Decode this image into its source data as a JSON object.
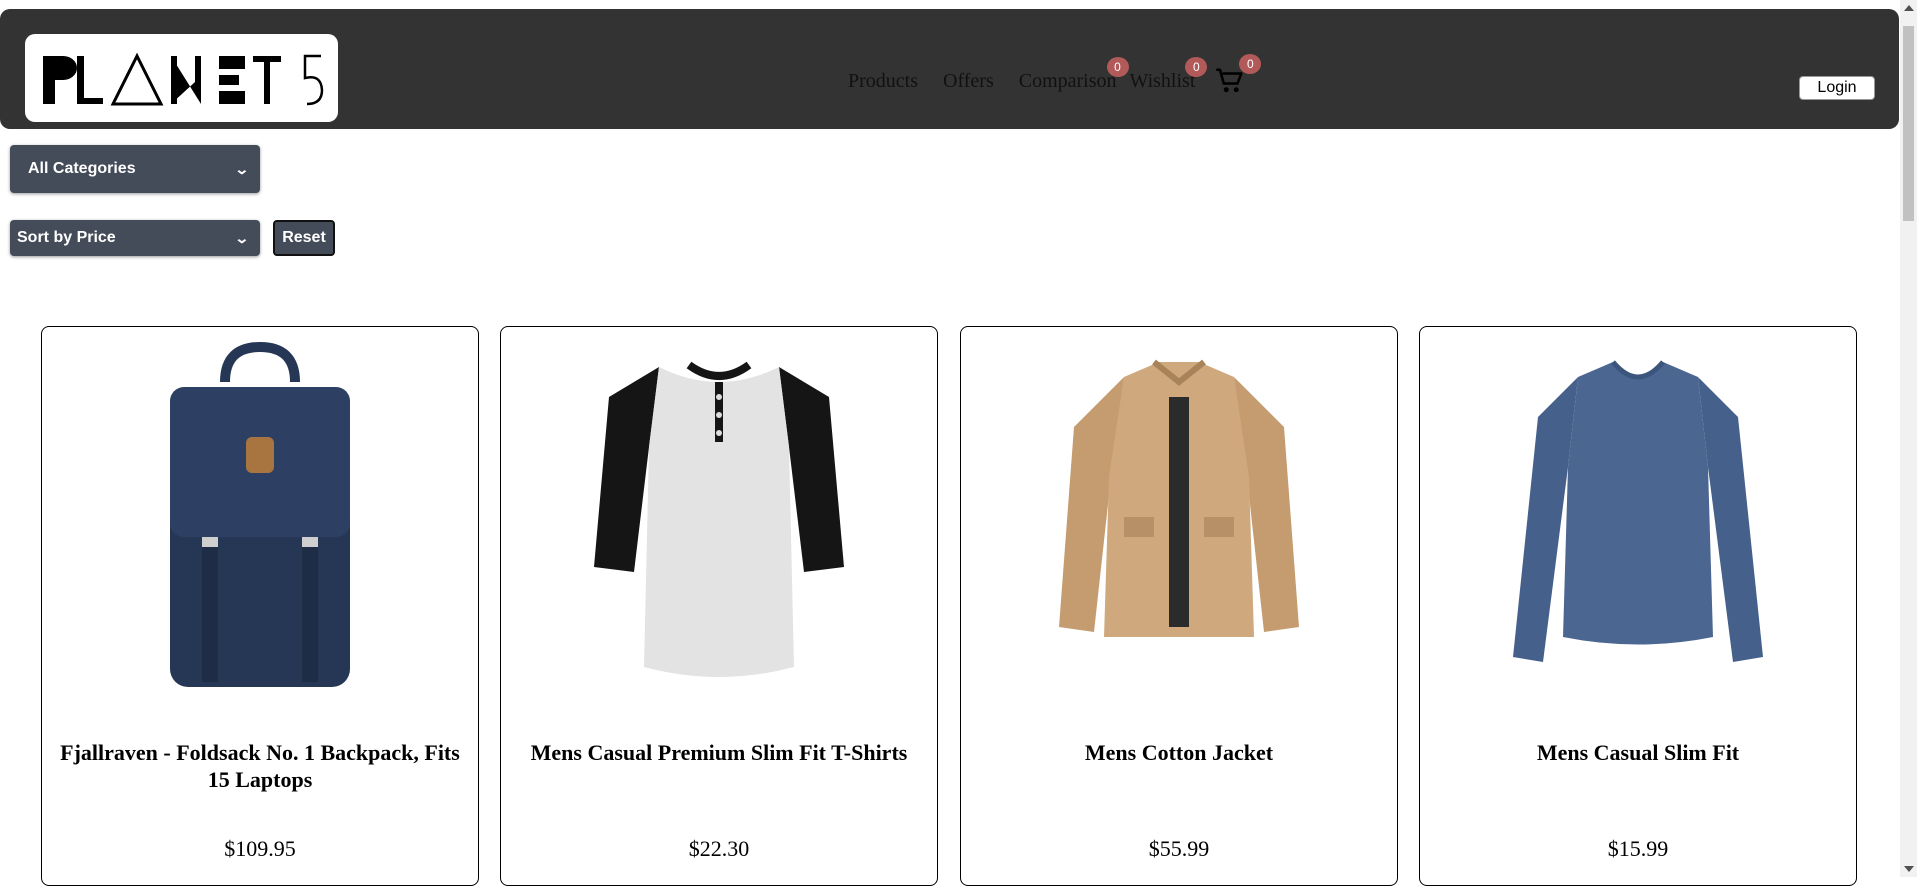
{
  "header": {
    "logo_text": "PLANET 5",
    "nav": [
      {
        "label": "Products"
      },
      {
        "label": "Offers"
      },
      {
        "label": "Comparison",
        "badge": "0"
      },
      {
        "label": "Wishlist",
        "badge": "0"
      }
    ],
    "cart": {
      "icon": "cart-icon",
      "badge": "0"
    },
    "login_label": "Login"
  },
  "filters": {
    "category_selected": "All Categories",
    "sort_selected": "Sort by Price",
    "reset_label": "Reset"
  },
  "products": [
    {
      "title": "Fjallraven - Foldsack No. 1 Backpack, Fits 15 Laptops",
      "price": "$109.95",
      "image": "backpack",
      "color": "#263755"
    },
    {
      "title": "Mens Casual Premium Slim Fit T-Shirts",
      "price": "$22.30",
      "image": "raglan-tshirt",
      "color": "#e3e3e3"
    },
    {
      "title": "Mens Cotton Jacket",
      "price": "$55.99",
      "image": "jacket",
      "color": "#cfa97d"
    },
    {
      "title": "Mens Casual Slim Fit",
      "price": "$15.99",
      "image": "longsleeve-shirt",
      "color": "#4b6691"
    }
  ],
  "colors": {
    "header_bg": "#333333",
    "control_bg": "#444b59",
    "badge_bg": "#b25a5a"
  }
}
